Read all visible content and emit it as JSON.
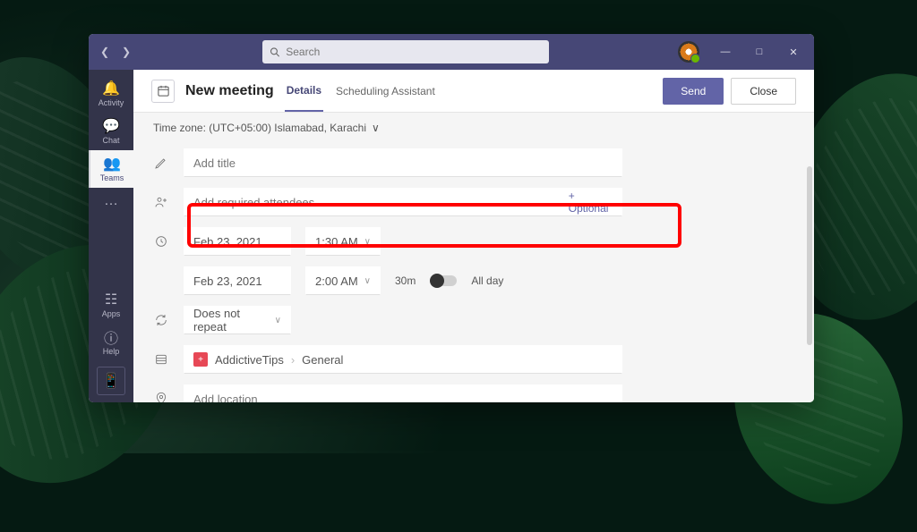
{
  "search": {
    "placeholder": "Search"
  },
  "sidebar": {
    "items": [
      {
        "label": "Activity"
      },
      {
        "label": "Chat"
      },
      {
        "label": "Teams"
      },
      {
        "label": ""
      },
      {
        "label": "Apps"
      },
      {
        "label": "Help"
      }
    ]
  },
  "header": {
    "title": "New meeting",
    "tabs": {
      "details": "Details",
      "scheduling": "Scheduling Assistant"
    },
    "send": "Send",
    "close": "Close"
  },
  "form": {
    "timezone_label": "Time zone: (UTC+05:00) Islamabad, Karachi",
    "title_placeholder": "Add title",
    "attendees_placeholder": "Add required attendees",
    "optional_label": "+ Optional",
    "start_date": "Feb 23, 2021",
    "start_time": "1:30 AM",
    "end_date": "Feb 23, 2021",
    "end_time": "2:00 AM",
    "duration": "30m",
    "allday": "All day",
    "repeat": "Does not repeat",
    "channel_team": "AddictiveTips",
    "channel_name": "General",
    "location_placeholder": "Add location"
  }
}
